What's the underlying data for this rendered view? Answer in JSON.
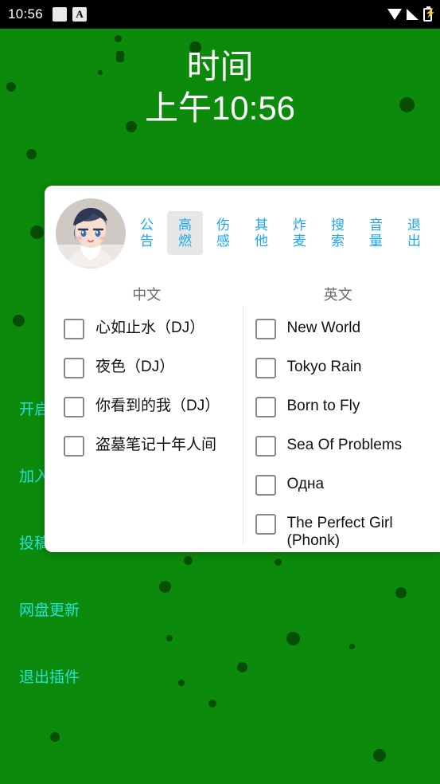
{
  "status_bar": {
    "clock": "10:56",
    "left_icons": [
      "white-square-icon",
      "letter-a-badge-icon"
    ],
    "letter_badge": "A",
    "right_icons": [
      "wifi-icon",
      "signal-icon",
      "battery-charging-icon"
    ]
  },
  "header": {
    "title": "时间",
    "value": "上午10:56"
  },
  "left_menu": {
    "items": [
      {
        "label": "开启悬浮窗"
      },
      {
        "label": "加入群聊"
      },
      {
        "label": "投稿反馈"
      },
      {
        "label": "网盘更新"
      },
      {
        "label": "退出插件"
      }
    ]
  },
  "panel": {
    "avatar": "anime-avatar",
    "tabs": [
      {
        "label": "公告",
        "active": false
      },
      {
        "label": "高燃",
        "active": true
      },
      {
        "label": "伤感",
        "active": false
      },
      {
        "label": "其他",
        "active": false
      },
      {
        "label": "炸麦",
        "active": false
      },
      {
        "label": "搜索",
        "active": false
      },
      {
        "label": "音量",
        "active": false
      },
      {
        "label": "退出",
        "active": false
      }
    ],
    "columns": [
      {
        "header": "中文",
        "items": [
          {
            "label": "心如止水（DJ）",
            "checked": false
          },
          {
            "label": "夜色（DJ）",
            "checked": false
          },
          {
            "label": "你看到的我（DJ）",
            "checked": false
          },
          {
            "label": "盗墓笔记十年人间",
            "checked": false
          }
        ]
      },
      {
        "header": "英文",
        "items": [
          {
            "label": "New World",
            "checked": false
          },
          {
            "label": "Tokyo Rain",
            "checked": false
          },
          {
            "label": "Born to Fly",
            "checked": false
          },
          {
            "label": "Sea Of Problems",
            "checked": false
          },
          {
            "label": "Одна",
            "checked": false
          },
          {
            "label": "The Perfect Girl (Phonk)",
            "checked": false
          }
        ]
      }
    ]
  },
  "colors": {
    "background_green": "#0b8a0b",
    "dot_green": "#064d06",
    "panel_white": "#ffffff",
    "tab_blue": "#1ea7f0",
    "menu_cyan": "#29e0d6",
    "tab_active_bg": "#e7e7e7"
  }
}
